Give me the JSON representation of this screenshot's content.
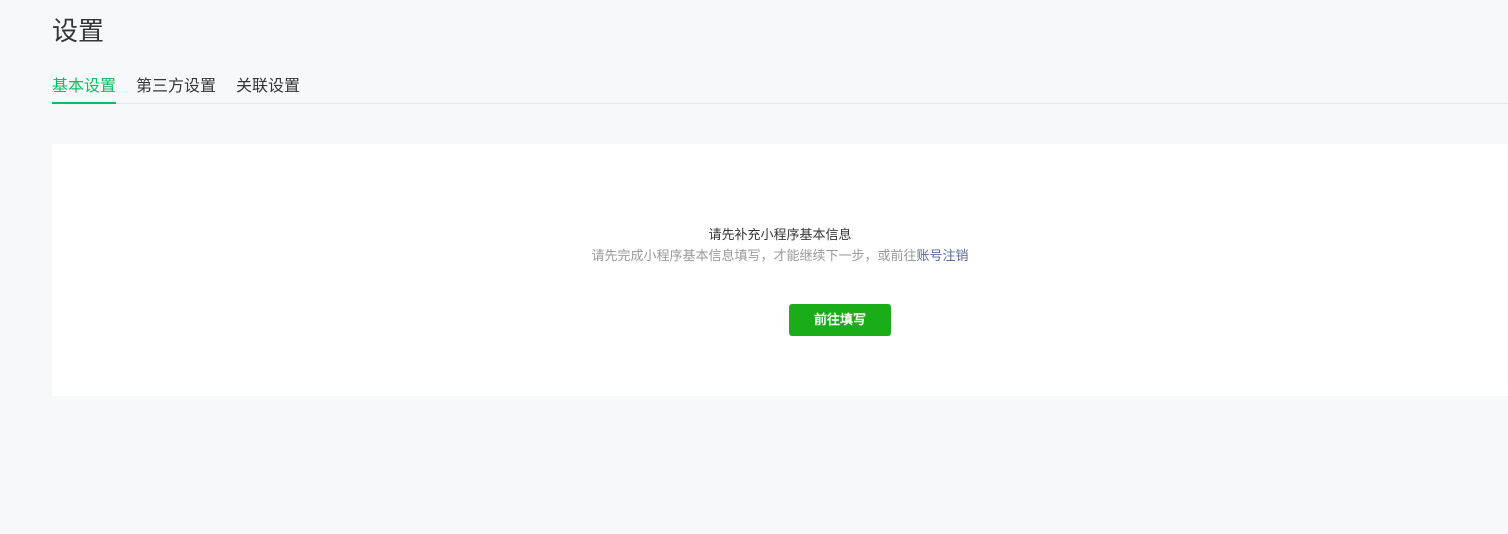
{
  "page": {
    "title": "设置"
  },
  "tabs": [
    {
      "label": "基本设置",
      "active": true
    },
    {
      "label": "第三方设置",
      "active": false
    },
    {
      "label": "关联设置",
      "active": false
    }
  ],
  "notice": {
    "title": "请先补充小程序基本信息",
    "description": "请先完成小程序基本信息填写，才能继续下一步，或前往",
    "link_label": "账号注销",
    "button_label": "前往填写"
  },
  "colors": {
    "accent": "#07c160",
    "button": "#1aad19",
    "link": "#576b95",
    "background": "#f7f8fa"
  }
}
